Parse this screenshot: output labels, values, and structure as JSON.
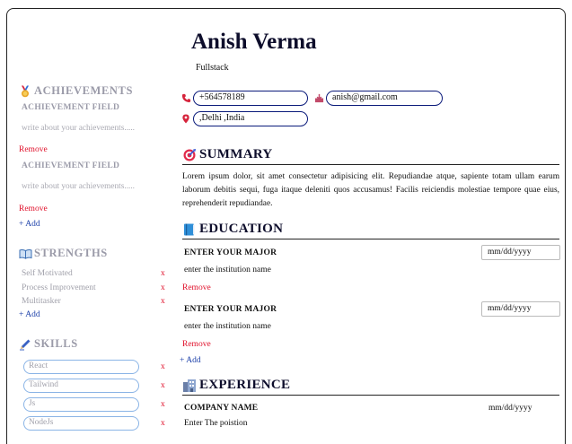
{
  "header": {
    "name": "Anish Verma",
    "role": "Fullstack"
  },
  "contact": {
    "phone": "+564578189",
    "email": "anish@gmail.com",
    "location": ",Delhi ,India"
  },
  "summary": {
    "title": "SUMMARY",
    "text": "Lorem ipsum dolor, sit amet consectetur adipisicing elit. Repudiandae atque, sapiente totam ullam earum laborum debitis sequi, fuga itaque deleniti quos accusamus! Facilis reiciendis molestiae tempore quae eius, reprehenderit repudiandae."
  },
  "education": {
    "title": "EDUCATION",
    "entries": [
      {
        "major": "ENTER YOUR MAJOR",
        "institution": "enter the institution name",
        "date": "mm/dd/yyyy",
        "remove": "Remove"
      },
      {
        "major": "ENTER YOUR MAJOR",
        "institution": "enter the institution name",
        "date": "mm/dd/yyyy",
        "remove": "Remove"
      }
    ],
    "add": "+ Add"
  },
  "experience": {
    "title": "EXPERIENCE",
    "entries": [
      {
        "company": "COMPANY NAME",
        "position": "Enter The poistion",
        "date": "mm/dd/yyyy"
      }
    ]
  },
  "achievements": {
    "title": "ACHIEVEMENTS",
    "entries": [
      {
        "field": "ACHIEVEMENT FIELD",
        "placeholder": "write about your achievements.....",
        "remove": "Remove"
      },
      {
        "field": "ACHIEVEMENT FIELD",
        "placeholder": "write about your achievements.....",
        "remove": "Remove"
      }
    ],
    "add": "+ Add"
  },
  "strengths": {
    "title": "STRENGTHS",
    "items": [
      "Self Motivated",
      "Process Improvement",
      "Multitasker"
    ],
    "remove_glyph": "x",
    "add": "+ Add"
  },
  "skills": {
    "title": "SKILLS",
    "items": [
      "React",
      "Tailwind",
      "Js",
      "NodeJs"
    ],
    "remove_glyph": "x"
  },
  "icons": {
    "phone": "phone-icon",
    "email": "mail-icon",
    "location": "pin-icon",
    "summary": "target-icon",
    "education": "book-icon",
    "experience": "building-icon",
    "achievements": "medal-icon",
    "strengths": "open-book-icon",
    "skills": "pen-icon"
  },
  "colors": {
    "remove": "#e0102a",
    "add": "#1a3ea8",
    "heading": "#0d0d2b",
    "muted": "#9a9aa8",
    "pill_border": "#0a1a7a",
    "skill_border": "#8ab4e6"
  }
}
